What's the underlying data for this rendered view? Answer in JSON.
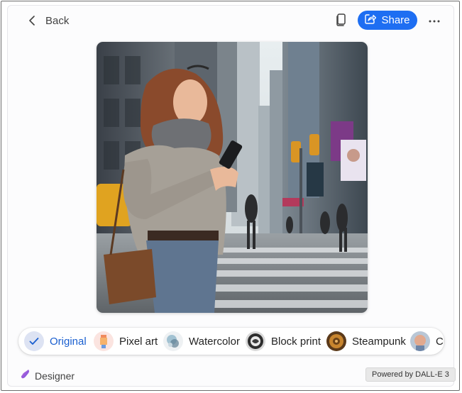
{
  "header": {
    "back_label": "Back",
    "share_label": "Share"
  },
  "image": {
    "description_icon": "generated-image"
  },
  "styles": {
    "items": [
      {
        "label": "Original",
        "selected": true
      },
      {
        "label": "Pixel art",
        "selected": false
      },
      {
        "label": "Watercolor",
        "selected": false
      },
      {
        "label": "Block print",
        "selected": false
      },
      {
        "label": "Steampunk",
        "selected": false
      },
      {
        "label": "Cla",
        "selected": false
      }
    ]
  },
  "footer": {
    "designer_label": "Designer",
    "powered_label": "Powered by DALL-E 3"
  },
  "colors": {
    "accent": "#1e6ef2",
    "selected_text": "#1a5fcf"
  }
}
